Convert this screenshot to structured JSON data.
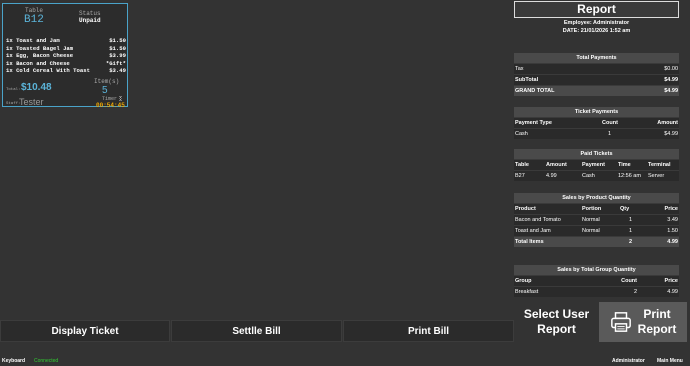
{
  "ticket": {
    "table_label": "Table",
    "table_value": "B12",
    "status_label": "Status",
    "status_value": "Unpaid",
    "items": [
      {
        "desc": "1x Toast and Jam",
        "price": "$1.50"
      },
      {
        "desc": "1x Toasted Bagel Jam",
        "price": "$1.50"
      },
      {
        "desc": "1x Egg, Bacon Cheese",
        "price": "$3.99"
      },
      {
        "desc": "1x Bacon and Cheese",
        "price": "*Gift*"
      },
      {
        "desc": "1x Cold Cereal With Toast",
        "price": "$3.49"
      }
    ],
    "total_label": "Total:",
    "total_value": "$10.48",
    "items_count_label": "Item(s)",
    "items_count_value": "5",
    "staff_label": "Staff:",
    "staff_value": "Tester",
    "timer_label": "Timer",
    "timer_value": "00:54:45"
  },
  "buttons": {
    "display_ticket": "Display Ticket",
    "settle_bill": "Settlle Bill",
    "print_bill": "Print Bill",
    "select_user_report_line1": "Select User",
    "select_user_report_line2": "Report",
    "print_report_line1": "Print",
    "print_report_line2": "Report"
  },
  "statusbar": {
    "keyboard": "Keyboard",
    "connection": "Connected",
    "user": "Administrator",
    "main_menu": "Main Menu"
  },
  "colors": {
    "accent": "#4aa3c9",
    "timer": "#f0a800",
    "connected": "#33cc33",
    "background": "#333333"
  },
  "report": {
    "title": "Report",
    "employee": "Employee: Administrator",
    "date": "DATE:  21/01/2026   1:52 am",
    "total_payments": {
      "title": "Total Payments",
      "rows": [
        {
          "label": "Tax",
          "value": "$0.00"
        },
        {
          "label": "SubTotal",
          "value": "$4.99"
        },
        {
          "label": "GRAND TOTAL",
          "value": "$4.99"
        }
      ]
    },
    "ticket_payments": {
      "title": "Ticket Payments",
      "headers": [
        "Payment Type",
        "Count",
        "Amount"
      ],
      "rows": [
        [
          "Cash",
          "1",
          "$4.99"
        ]
      ]
    },
    "paid_tickets": {
      "title": "Paid Tickets",
      "headers": [
        "Table",
        "Amount",
        "Payment",
        "Time",
        "Terminal"
      ],
      "rows": [
        [
          "B27",
          "4.99",
          "Cash",
          "12:56 am",
          "Server"
        ]
      ]
    },
    "sales_by_product": {
      "title": "Sales by Product Quantity",
      "headers": [
        "Product",
        "Portion",
        "Qty",
        "Price"
      ],
      "rows": [
        [
          "Bacon and Tomato",
          "Normal",
          "1",
          "3.49"
        ],
        [
          "Toast and Jam",
          "Normal",
          "1",
          "1.50"
        ]
      ],
      "total": [
        "Total Items",
        "",
        "2",
        "4.99"
      ]
    },
    "sales_by_group": {
      "title": "Sales by Total Group Quantity",
      "headers": [
        "Group",
        "Count",
        "Price"
      ],
      "rows": [
        [
          "Breakfast",
          "2",
          "4.99"
        ]
      ]
    }
  }
}
